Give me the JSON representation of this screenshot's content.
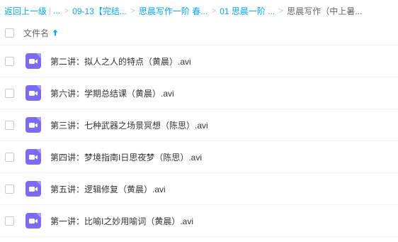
{
  "breadcrumb": {
    "items": [
      {
        "label": "返回上一级"
      },
      {
        "label": "..."
      },
      {
        "label": "09-13【完结..."
      },
      {
        "label": "思晨写作一阶 春..."
      },
      {
        "label": "01 思晨一阶 ..."
      },
      {
        "label": "思晨写作（中上暑..."
      }
    ],
    "divider_bar": "|",
    "divider_arrow": ">"
  },
  "header": {
    "column_label": "文件名",
    "sort_icon": "arrow-up-icon"
  },
  "files": [
    {
      "name": "第二讲：拟人之人的特点（黄晨）.avi",
      "icon": "video-file-icon"
    },
    {
      "name": "第六讲：学期总结课（黄晨）.avi",
      "icon": "video-file-icon"
    },
    {
      "name": "第三讲：七种武器之场景冥想（陈思）.avi",
      "icon": "video-file-icon"
    },
    {
      "name": "第四讲：梦境指南I日思夜梦（陈思）.avi",
      "icon": "video-file-icon"
    },
    {
      "name": "第五讲：逻辑修复（黄晨）.avi",
      "icon": "video-file-icon"
    },
    {
      "name": "第一讲：比喻I之妙用喻词（黄晨）.avi",
      "icon": "video-file-icon"
    }
  ],
  "colors": {
    "link": "#06a7ff",
    "video_icon": "#7b6bf3"
  }
}
